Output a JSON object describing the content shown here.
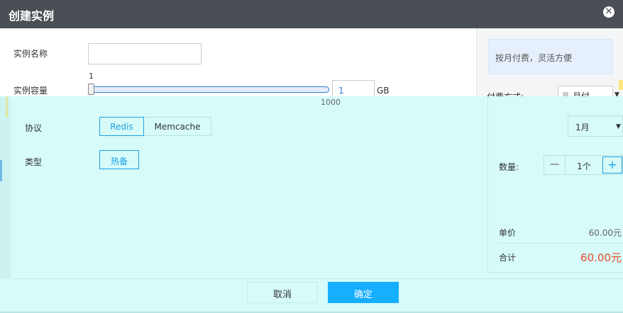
{
  "dialog": {
    "title": "创建实例",
    "close_icon": "close-icon"
  },
  "form": {
    "name_label": "实例名称",
    "name_value": "",
    "capacity_label": "实例容量",
    "capacity_min": "1",
    "capacity_max": "1000",
    "capacity_value": "1",
    "capacity_unit": "GB",
    "capacity_level": 0,
    "protocol_label": "协议",
    "protocol_options": [
      "Redis",
      "Memcache"
    ],
    "protocol_selected": "Redis",
    "type_label": "类型",
    "type_options": [
      "热备"
    ],
    "type_selected": "热备"
  },
  "billing": {
    "promo_text": "按月付费，灵活方便",
    "pay_label": "付费方式:",
    "pay_select_value": "月付",
    "period_value": "1月",
    "quantity_label": "数量:",
    "quantity_value": "1个",
    "minus_symbol": "—",
    "plus_symbol": "+",
    "unit_price_label": "单价",
    "unit_price_value": "60.00元",
    "total_label": "合计",
    "total_value": "60.00元"
  },
  "footer": {
    "cancel_label": "取消",
    "ok_label": "确定"
  },
  "colors": {
    "titlebar": "#4a4e55",
    "accent": "#1f9fe5",
    "primary_button": "#16aeff",
    "overlay": "#d6fbf8",
    "total_price": "#e84a2b"
  }
}
